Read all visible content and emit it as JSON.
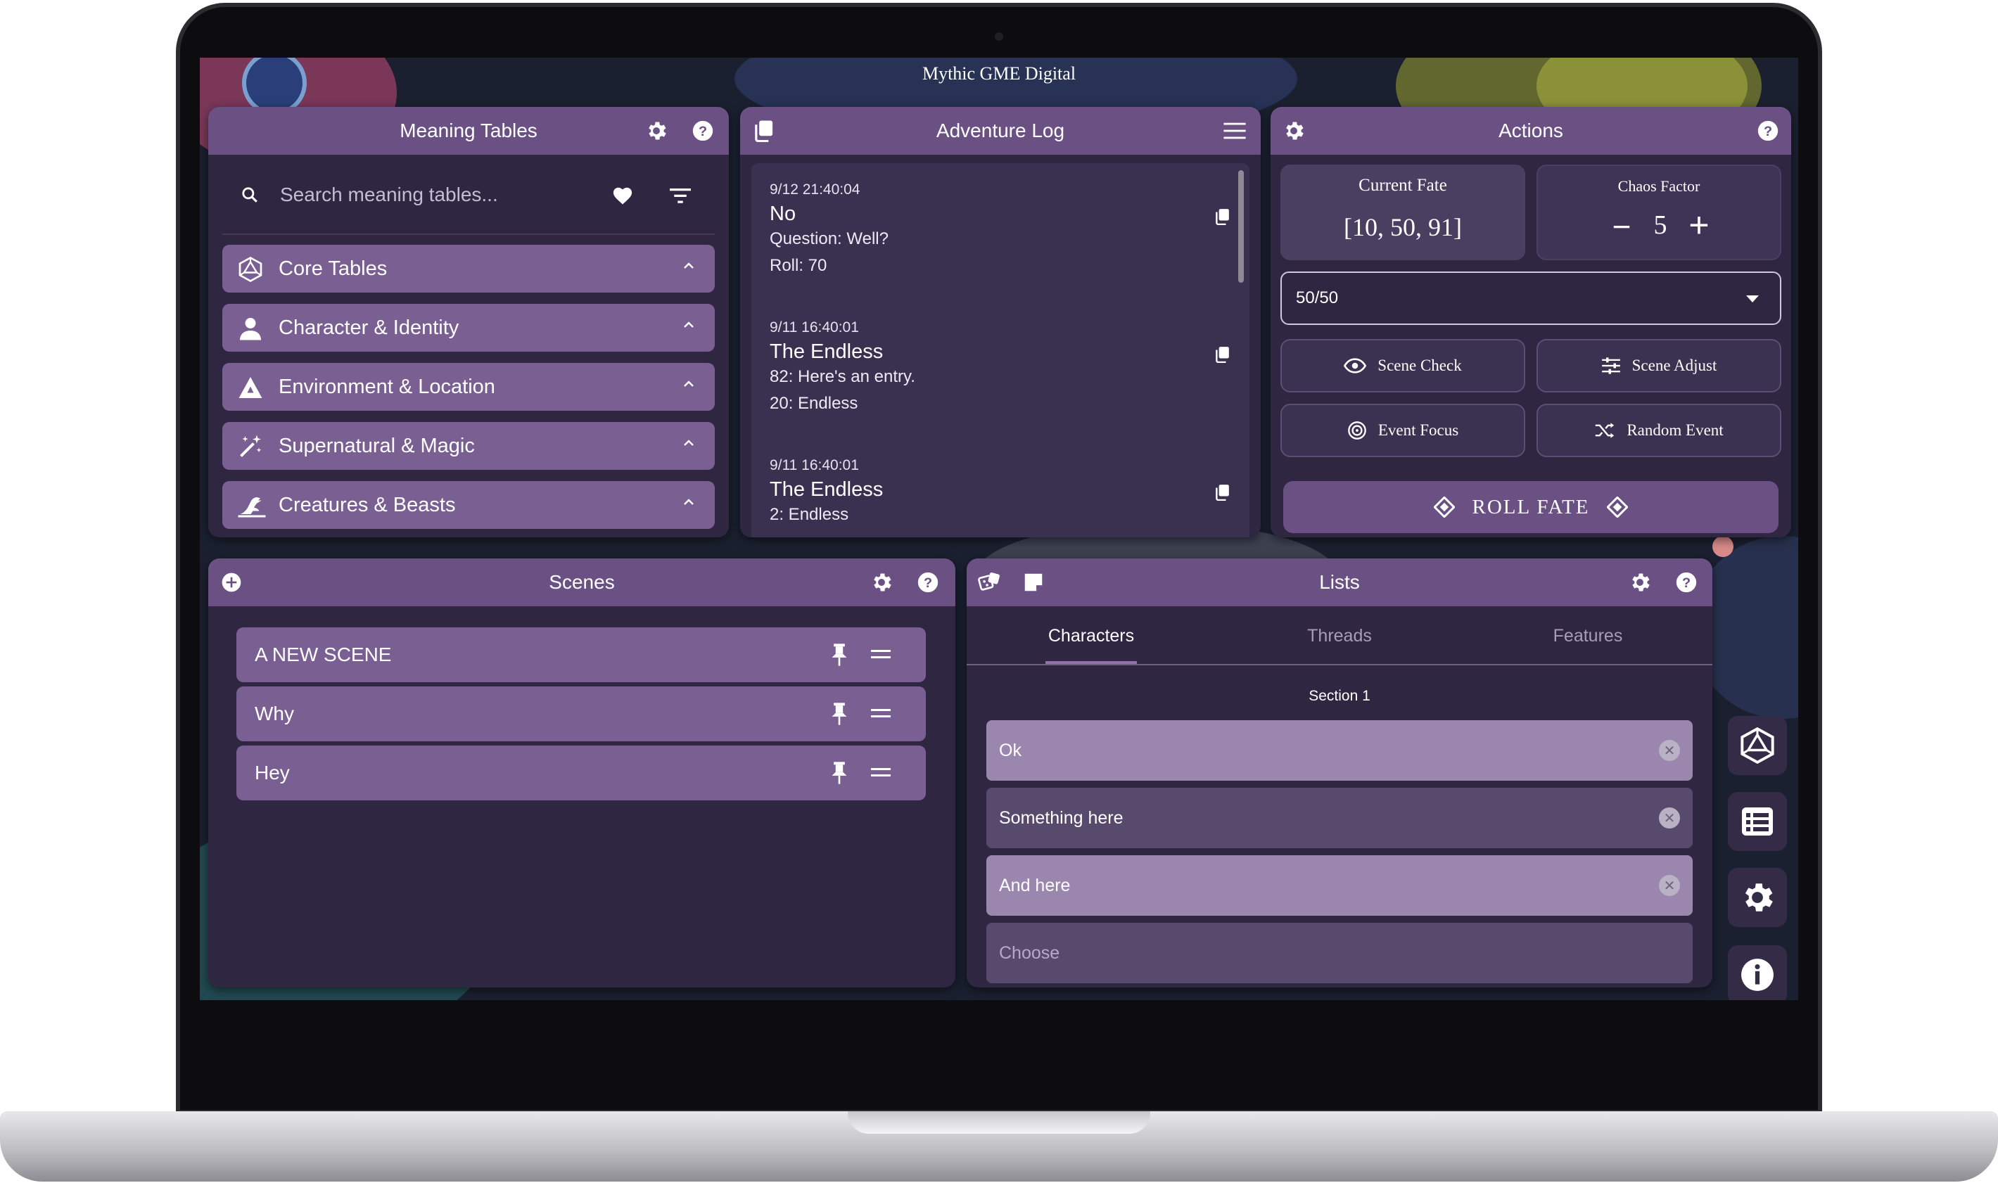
{
  "app": {
    "title": "Mythic GME Digital"
  },
  "meaning_tables": {
    "title": "Meaning Tables",
    "search_placeholder": "Search meaning tables...",
    "categories": [
      {
        "label": "Core Tables",
        "icon": "d20-icon"
      },
      {
        "label": "Character & Identity",
        "icon": "person-icon"
      },
      {
        "label": "Environment & Location",
        "icon": "mountain-icon"
      },
      {
        "label": "Supernatural & Magic",
        "icon": "magic-wand-icon"
      },
      {
        "label": "Creatures & Beasts",
        "icon": "dragon-icon"
      }
    ]
  },
  "adventure_log": {
    "title": "Adventure Log",
    "entries": [
      {
        "timestamp": "9/12 21:40:04",
        "title": "No",
        "lines": [
          "Question: Well?",
          "Roll: 70"
        ]
      },
      {
        "timestamp": "9/11 16:40:01",
        "title": "The Endless",
        "lines": [
          "82: Here's an entry.",
          "20: Endless"
        ]
      },
      {
        "timestamp": "9/11 16:40:01",
        "title": "The Endless",
        "lines": [
          "2: Endless"
        ]
      }
    ]
  },
  "actions": {
    "title": "Actions",
    "current_fate_label": "Current Fate",
    "current_fate_value": "[10, 50, 91]",
    "chaos_factor_label": "Chaos Factor",
    "chaos_factor_value": "5",
    "chaos_minus": "−",
    "chaos_plus": "+",
    "odds_selected": "50/50",
    "buttons": {
      "scene_check": "Scene Check",
      "scene_adjust": "Scene Adjust",
      "event_focus": "Event Focus",
      "random_event": "Random Event",
      "roll_fate": "ROLL FATE"
    }
  },
  "scenes": {
    "title": "Scenes",
    "items": [
      {
        "label": "A NEW SCENE"
      },
      {
        "label": "Why"
      },
      {
        "label": "Hey"
      }
    ]
  },
  "lists": {
    "title": "Lists",
    "tabs": [
      "Characters",
      "Threads",
      "Features"
    ],
    "active_tab": "Characters",
    "section_label": "Section 1",
    "items": [
      {
        "label": "Ok",
        "style": "light"
      },
      {
        "label": "Something here",
        "style": "dark"
      },
      {
        "label": "And here",
        "style": "light"
      }
    ],
    "choose_placeholder": "Choose"
  },
  "dock": [
    "d20-icon",
    "list-icon",
    "gear-icon",
    "info-icon"
  ],
  "colors": {
    "header": "#6b5183",
    "panel": "#2f2742",
    "item": "#7a5f92",
    "list_light": "#9b86ad",
    "list_dark": "#574a6c"
  }
}
